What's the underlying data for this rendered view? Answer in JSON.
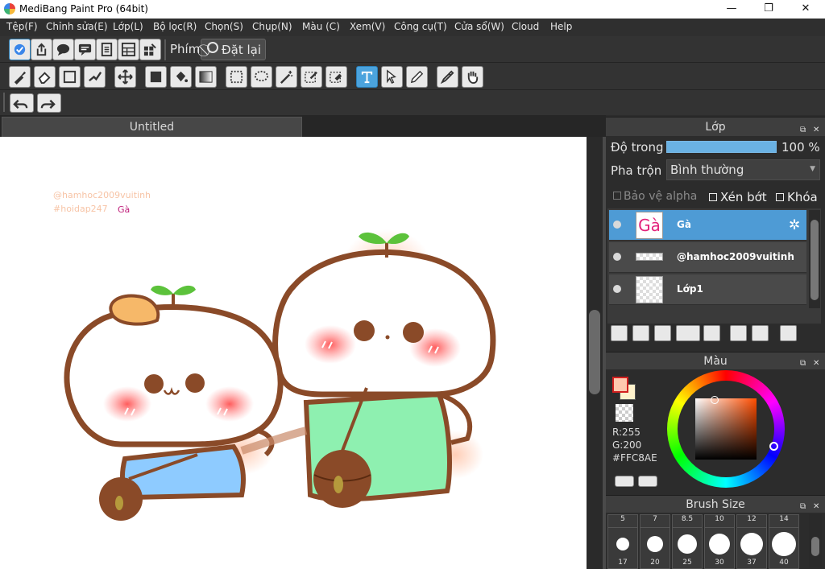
{
  "window": {
    "title": "MediBang Paint Pro (64bit)",
    "minimize": "—",
    "maximize": "❐",
    "close": "✕"
  },
  "menu": [
    "Tệp(F)",
    "Chỉnh sửa(E)",
    "Lớp(L)",
    "Bộ lọc(R)",
    "Chọn(S)",
    "Chụp(N)",
    "Màu (C)",
    "Xem(V)",
    "Công cụ(T)",
    "Cửa sổ(W)",
    "Cloud",
    "Help"
  ],
  "toolbar1": {
    "shortcut_label": "Phím",
    "reset_label": "Đặt lại"
  },
  "document": {
    "tab_title": "Untitled"
  },
  "canvas_text": {
    "credit": "@hamhoc2009vuitinh",
    "tag": "#hoidap247",
    "layer_text": "Gà"
  },
  "layer_panel": {
    "title": "Lớp",
    "opacity_label": "Độ trong",
    "opacity_value": "100 %",
    "opacity_fraction": 1.0,
    "blend_label": "Pha trộn",
    "blend_value": "Bình thường",
    "protect_alpha": "Bảo vệ alpha",
    "clipping": "Xén bớt",
    "lock": "Khóa",
    "layers": [
      {
        "name": "Gà",
        "selected": true,
        "thumb_text": "Gà"
      },
      {
        "name": "@hamhoc2009vuitinh",
        "selected": false
      },
      {
        "name": "Lớp1",
        "selected": false
      }
    ]
  },
  "color_panel": {
    "title": "Màu",
    "r_label": "R:255",
    "g_label": "G:200",
    "hex_label": "#FFC8AE",
    "fg_color": "#FFC8AE",
    "bg_color": "#FFF2CC"
  },
  "brush_panel": {
    "title": "Brush Size",
    "row1": [
      "5",
      "7",
      "8.5",
      "10",
      "12",
      "14"
    ],
    "row2": [
      "17",
      "20",
      "25",
      "30",
      "37",
      "40"
    ]
  },
  "colors": {
    "accent": "#4ba3dd",
    "selected_layer": "#4e9bd5",
    "brown": "#8a4a28",
    "blush": "#ff5a5a",
    "leaf": "#5cc23b"
  }
}
